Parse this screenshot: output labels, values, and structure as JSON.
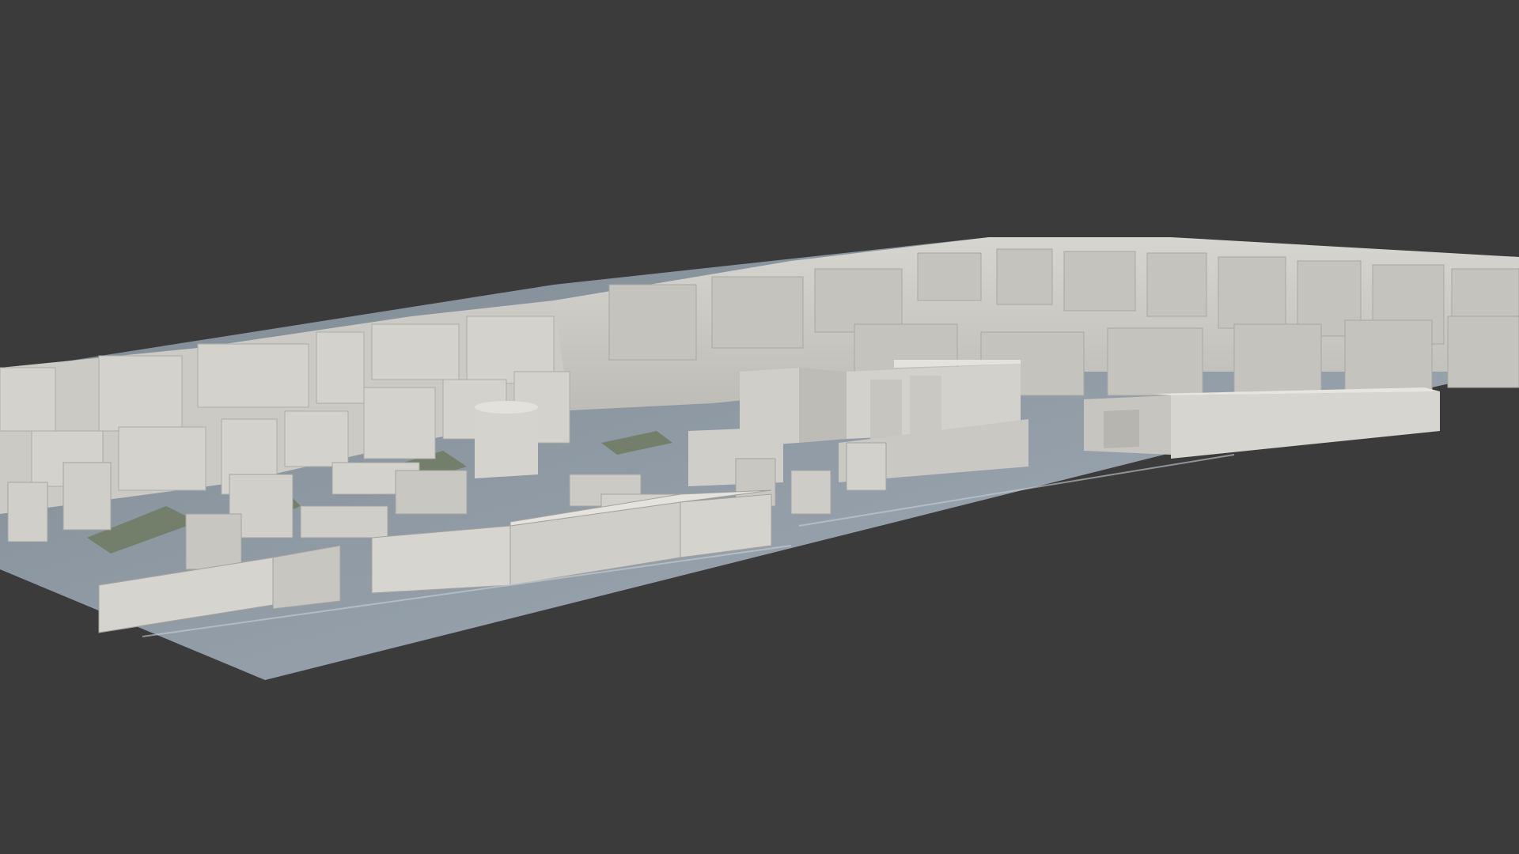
{
  "viewport": {
    "background_color": "#3b3b3b",
    "ground_color": "#8b96a0",
    "building_top_color": "#d9d8d3",
    "building_side_color": "#b8b7b1",
    "building_front_color": "#c9c8c2",
    "vegetation_color": "#6f7a62",
    "scene_content": "3d-city-block-model"
  }
}
